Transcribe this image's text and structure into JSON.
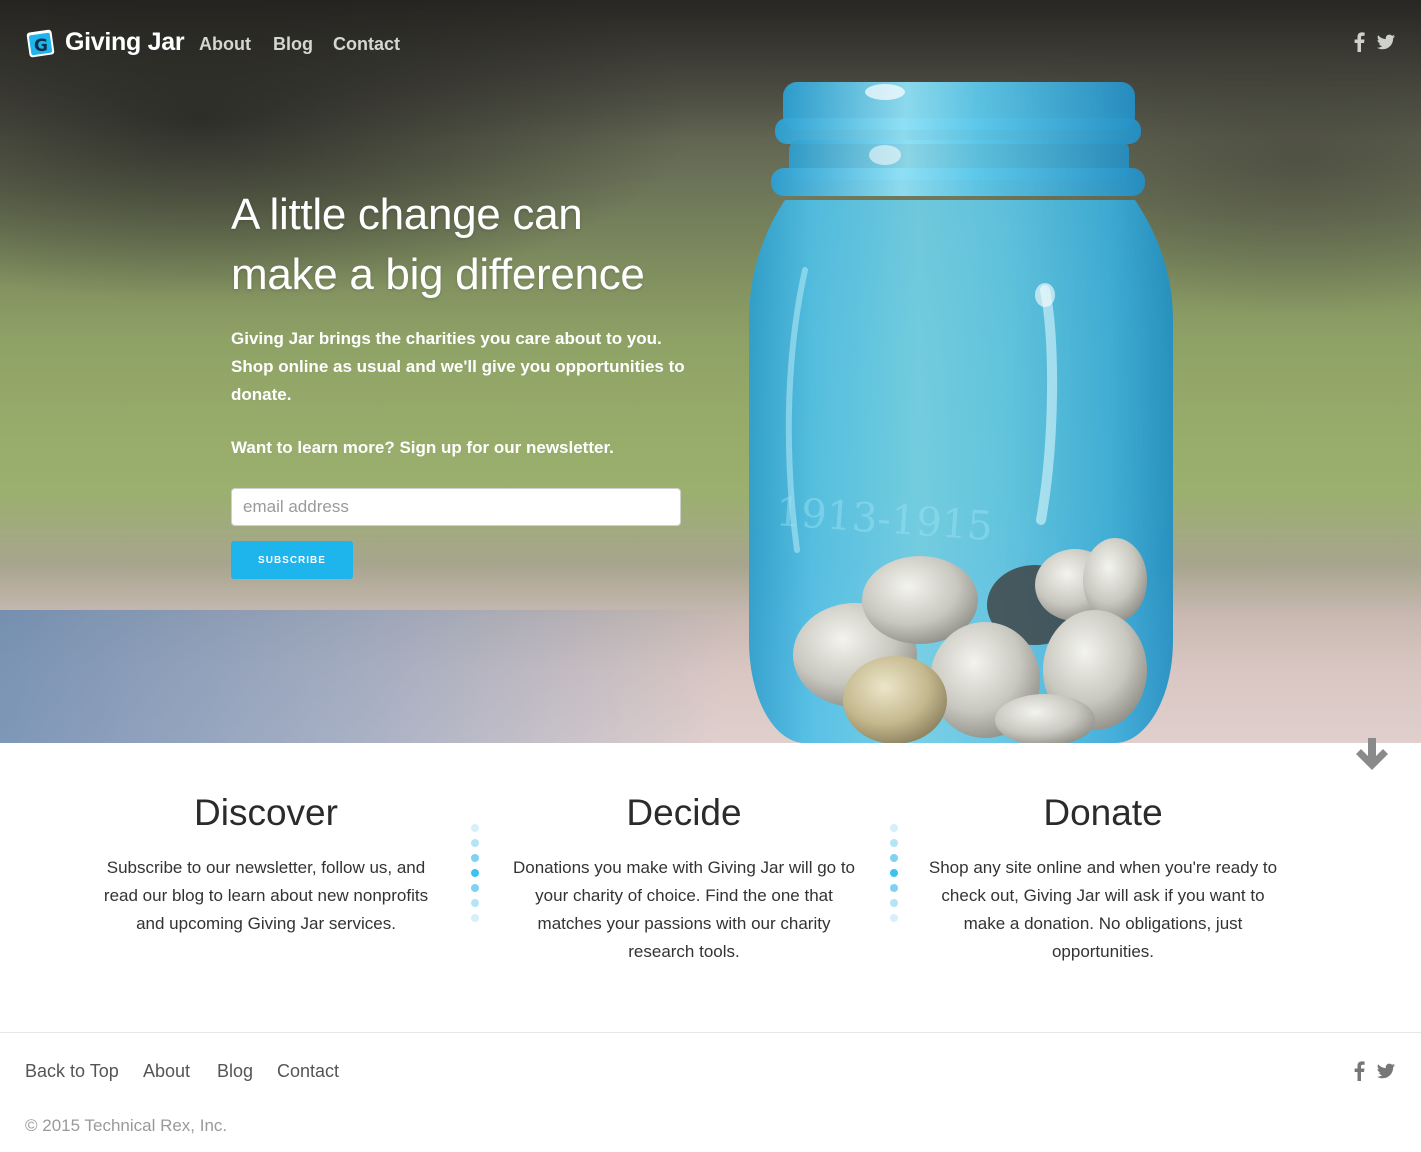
{
  "nav": {
    "brand": "Giving Jar",
    "links": [
      "About",
      "Blog",
      "Contact"
    ]
  },
  "hero": {
    "headline_line1": "A little change can",
    "headline_line2": "make a big difference",
    "lead": "Giving Jar brings the charities you care about to you. Shop online as usual and we'll give you opportunities to donate.",
    "lead_sub": "Want to learn more? Sign up for our newsletter.",
    "email_placeholder": "email address",
    "subscribe_label": "SUBSCRIBE"
  },
  "features": [
    {
      "title": "Discover",
      "text": "Subscribe to our newsletter, follow us, and read our blog to learn about new nonprofits and upcoming Giving Jar services."
    },
    {
      "title": "Decide",
      "text": "Donations you make with Giving Jar will go to your charity of choice. Find the one that matches your passions with our charity research tools."
    },
    {
      "title": "Donate",
      "text": "Shop any site online and when you're ready to check out, Giving Jar will ask if you want to make a donation. No obligations, just opportunities."
    }
  ],
  "footer": {
    "links": [
      "Back to Top",
      "About",
      "Blog",
      "Contact"
    ],
    "copyright": "© 2015 Technical Rex, Inc."
  },
  "icons": {
    "logo": "giving-jar-logo-icon",
    "facebook": "facebook-icon",
    "twitter": "twitter-icon",
    "down_arrow": "arrow-down-icon"
  },
  "colors": {
    "accent": "#1eb4ec",
    "dot_light": "#c9ecf9",
    "dot_mid": "#8fd6f3",
    "dot_dark": "#3fc1ef",
    "arrow": "#8a8a8a",
    "nav_link": "#d4d7cf"
  }
}
